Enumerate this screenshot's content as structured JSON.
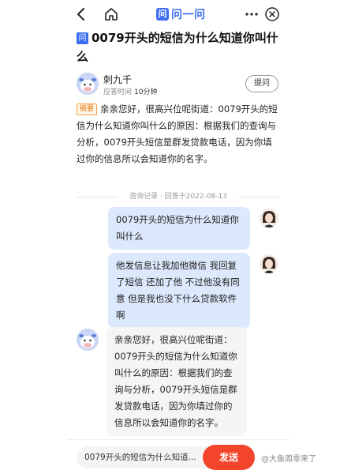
{
  "topbar": {
    "brand_badge": "问",
    "brand_name": "问一问",
    "icons": [
      "back-arrow-icon",
      "home-icon",
      "more-icon",
      "close-circle-icon"
    ]
  },
  "question": {
    "badge": "问",
    "title": "0079开头的短信为什么知道你叫什么"
  },
  "author": {
    "name": "刺九千",
    "meta_label": "应答时间",
    "meta_value": "10分钟",
    "ask_button": "提问"
  },
  "summary": {
    "tag": "摘要",
    "text": "亲亲您好，很高兴位呢街道：0079开头的短信为什么知道你叫什么的原因：根据我们的查询与分析，0079开头短信是群发贷款电话，因为你填过你的信息所以会知道你的名字。"
  },
  "divider": "咨询记录 · 回答于2022-08-13",
  "chat": [
    {
      "from": "user",
      "text": "0079开头的短信为什么知道你叫什么"
    },
    {
      "from": "user",
      "text": "他发信息让我加他微信 我回复了短信 还加了他 不过他没有同意 但是我也没下什么贷款软件啊"
    },
    {
      "from": "bot",
      "text": "亲亲您好，很高兴位呢街道：0079开头的短信为什么知道你叫什么的原因：根据我们的查询与分析，0079开头短信是群发贷款电话，因为你填过你的信息所以会知道你的名字。"
    }
  ],
  "bottom": {
    "input_value": "0079开头的短信为什么知道...",
    "send_label": "发送"
  },
  "watermark": "@大鱼周零来了",
  "colors": {
    "brand_blue": "#3a6df0",
    "send_red": "#f2452c",
    "user_bubble": "#dce8fb",
    "bot_bubble": "#f5f5f5",
    "summary_tag": "#e07a10"
  }
}
